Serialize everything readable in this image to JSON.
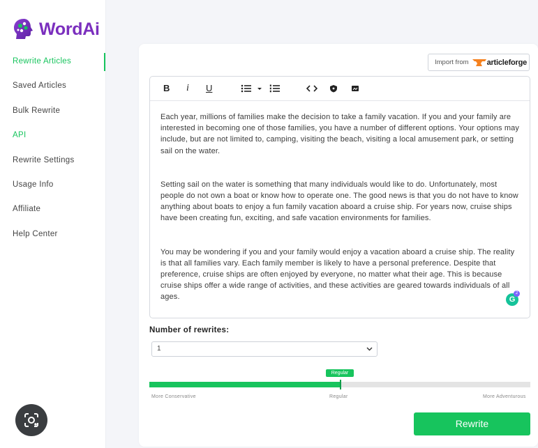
{
  "brand": {
    "name_part1": "Word",
    "name_part2": "Ai",
    "color": "#7b2fbe"
  },
  "accent_color": "#17c45d",
  "sidebar": {
    "items": [
      {
        "label": "Rewrite Articles",
        "state": "active"
      },
      {
        "label": "Saved Articles"
      },
      {
        "label": "Bulk Rewrite"
      },
      {
        "label": "API",
        "state": "highlight"
      },
      {
        "label": "Rewrite Settings"
      },
      {
        "label": "Usage Info"
      },
      {
        "label": "Affiliate"
      },
      {
        "label": "Help Center"
      }
    ]
  },
  "import": {
    "label": "Import from",
    "brand_part1": "article",
    "brand_part2": "forge"
  },
  "toolbar": {
    "bold": "B",
    "italic": "i",
    "underline": "U",
    "icons": [
      "bulleted-list-icon",
      "chevron-down-icon",
      "numbered-list-icon",
      "code-icon",
      "shield-icon",
      "image-icon"
    ]
  },
  "editor": {
    "paragraphs": [
      "Each year, millions of families make the decision to take a family vacation. If you and your family are interested in becoming one of those families, you have a number of different options. Your options may include, but are not limited to, camping, visiting the beach, visiting a local amusement park, or setting sail on the water.",
      "Setting sail on the water is something that many individuals would like to do. Unfortunately, most people do not own a boat or know how to operate one. The good news is that you do not have to know anything about boats to enjoy a fun family vacation aboard a cruise ship. For years now, cruise ships have been creating fun, exciting, and safe vacation environments for families.",
      "You may be wondering if you and your family would enjoy a vacation aboard a cruise ship. The reality is that all families vary. Each family member is likely to have a personal preference. Despite that preference, cruise ships are often enjoyed by everyone, no matter what their age. This is because cruise ships offer a wide range of activities, and these activities are geared towards individuals of all ages."
    ],
    "grammarly_letter": "G",
    "grammarly_count": "2"
  },
  "rewrites": {
    "label": "Number of rewrites:",
    "selected": "1"
  },
  "slider": {
    "tooltip": "Regular",
    "value": 0.5,
    "labels": {
      "left": "More Conservative",
      "middle": "Regular",
      "right": "More Adventurous"
    }
  },
  "rewrite_button": {
    "label": "Rewrite"
  }
}
